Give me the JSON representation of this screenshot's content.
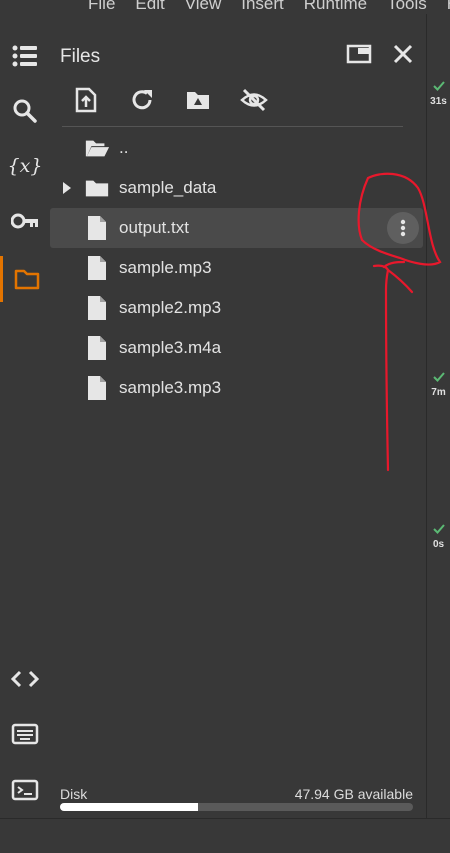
{
  "menu": [
    "File",
    "Edit",
    "View",
    "Insert",
    "Runtime",
    "Tools",
    "H"
  ],
  "sidebar": {
    "items": [
      {
        "name": "table-of-contents",
        "icon": "list-icon"
      },
      {
        "name": "search",
        "icon": "search-icon"
      },
      {
        "name": "variables",
        "icon": "variables-icon",
        "label": "{x}"
      },
      {
        "name": "secrets",
        "icon": "key-icon"
      },
      {
        "name": "files",
        "icon": "folder-icon",
        "active": true
      },
      {
        "name": "code-snippets",
        "icon": "code-icon"
      },
      {
        "name": "command-palette",
        "icon": "keyboard-icon"
      },
      {
        "name": "terminal",
        "icon": "terminal-icon"
      }
    ],
    "accent": "#e37400"
  },
  "files_panel": {
    "title": "Files",
    "toolbar": [
      "upload-icon",
      "refresh-icon",
      "drive-icon",
      "hide-icon"
    ],
    "entries": [
      {
        "name": "..",
        "type": "parent"
      },
      {
        "name": "sample_data",
        "type": "folder",
        "expandable": true
      },
      {
        "name": "output.txt",
        "type": "file",
        "selected": true
      },
      {
        "name": "sample.mp3",
        "type": "file"
      },
      {
        "name": "sample2.mp3",
        "type": "file"
      },
      {
        "name": "sample3.m4a",
        "type": "file"
      },
      {
        "name": "sample3.mp3",
        "type": "file"
      }
    ],
    "disk": {
      "label": "Disk",
      "available": "47.94 GB available",
      "used_fraction": 0.39
    }
  },
  "cells": [
    {
      "time": "31s",
      "status": "done"
    },
    {
      "time": "7m",
      "status": "done"
    },
    {
      "time": "0s",
      "status": "done"
    }
  ],
  "colors": {
    "check": "#5bb974",
    "annotation": "#e8182c"
  }
}
